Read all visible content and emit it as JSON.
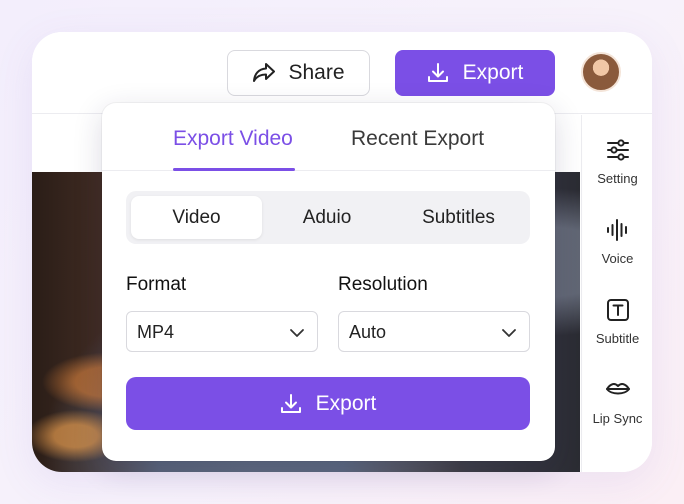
{
  "header": {
    "share_label": "Share",
    "export_label": "Export"
  },
  "sidebar": {
    "items": [
      {
        "label": "Setting",
        "icon": "sliders-icon"
      },
      {
        "label": "Voice",
        "icon": "waveform-icon"
      },
      {
        "label": "Subtitle",
        "icon": "text-box-icon"
      },
      {
        "label": "Lip Sync",
        "icon": "lips-icon"
      }
    ]
  },
  "export_panel": {
    "tabs": [
      {
        "label": "Export Video",
        "active": true
      },
      {
        "label": "Recent Export",
        "active": false
      }
    ],
    "segments": [
      {
        "label": "Video",
        "active": true
      },
      {
        "label": "Aduio",
        "active": false
      },
      {
        "label": "Subtitles",
        "active": false
      }
    ],
    "format": {
      "label": "Format",
      "value": "MP4"
    },
    "resolution": {
      "label": "Resolution",
      "value": "Auto"
    },
    "export_button_label": "Export"
  },
  "colors": {
    "accent": "#7b4fe6",
    "text": "#222222",
    "border": "#d9d9de"
  }
}
